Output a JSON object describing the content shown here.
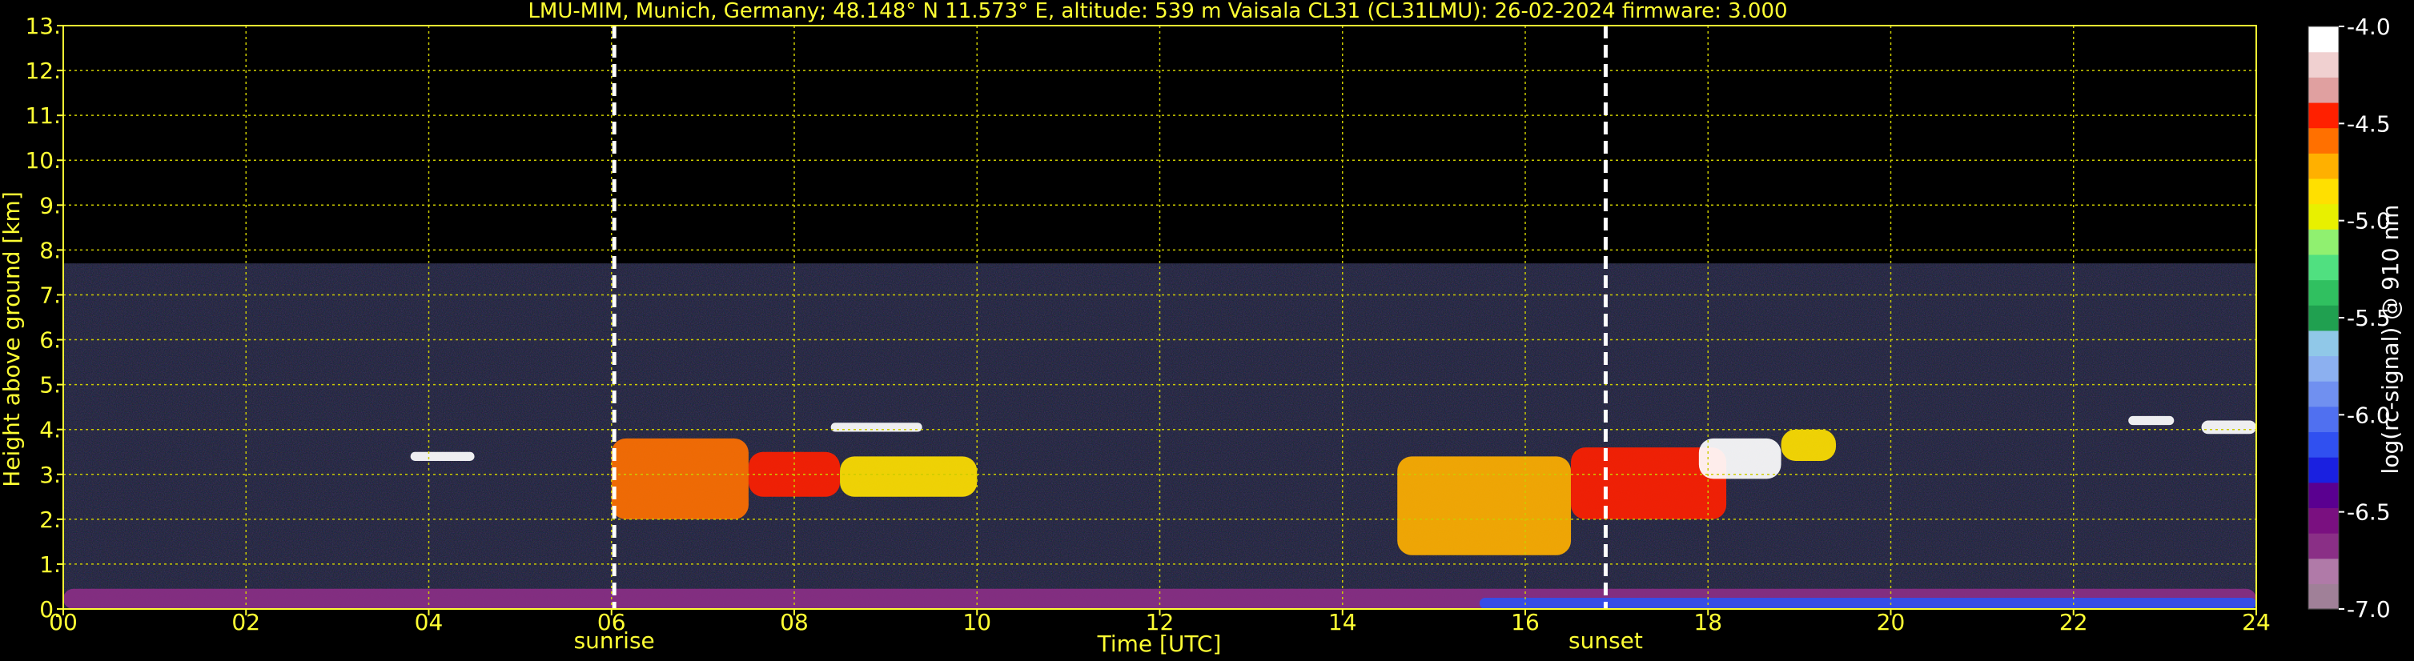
{
  "chart_data": {
    "type": "heatmap",
    "title": "LMU-MIM, Munich, Germany; 48.148° N 11.573° E, altitude: 539 m    Vaisala CL31 (CL31LMU): 26-02-2024    firmware: 3.000",
    "xlabel": "Time [UTC]",
    "ylabel": "Height above ground [km]",
    "colorbar_label": "log(rc-signal) @ 910 nm",
    "xlim": [
      0,
      24
    ],
    "ylim": [
      0,
      13
    ],
    "x_ticks": [
      0,
      2,
      4,
      6,
      8,
      10,
      12,
      14,
      16,
      18,
      20,
      22,
      24
    ],
    "x_tick_labels": [
      "00",
      "02",
      "04",
      "06",
      "08",
      "10",
      "12",
      "14",
      "16",
      "18",
      "20",
      "22",
      "24"
    ],
    "y_ticks": [
      0,
      1,
      2,
      3,
      4,
      5,
      6,
      7,
      8,
      9,
      10,
      11,
      12,
      13
    ],
    "y_tick_labels": [
      "0.",
      "1.",
      "2.",
      "3.",
      "4.",
      "5.",
      "6.",
      "7.",
      "8.",
      "9.",
      "10.",
      "11.",
      "12.",
      "13."
    ],
    "grid": true,
    "colorbar_range": [
      -7.0,
      -4.0
    ],
    "colorbar_ticks": [
      -7.0,
      -6.5,
      -6.0,
      -5.5,
      -5.0,
      -4.5,
      -4.0
    ],
    "colorbar_tick_labels": [
      "-7.0",
      "-6.5",
      "-6.0",
      "-5.5",
      "-5.0",
      "-4.5",
      "-4.0"
    ],
    "markers": [
      {
        "label": "sunrise",
        "x": 6.03
      },
      {
        "label": "sunset",
        "x": 16.88
      }
    ],
    "data_top_km": 7.7,
    "layers": [
      {
        "x_start": 0.0,
        "x_end": 24.0,
        "y_low": 0.0,
        "y_high": 0.45,
        "intensity": -6.7
      },
      {
        "x_start": 15.5,
        "x_end": 24.0,
        "y_low": 0.0,
        "y_high": 0.25,
        "intensity": -6.2
      },
      {
        "x_start": 3.8,
        "x_end": 4.5,
        "y_low": 3.3,
        "y_high": 3.5,
        "intensity": -4.1
      },
      {
        "x_start": 6.0,
        "x_end": 7.5,
        "y_low": 2.0,
        "y_high": 3.8,
        "intensity": -4.6
      },
      {
        "x_start": 7.5,
        "x_end": 8.5,
        "y_low": 2.5,
        "y_high": 3.5,
        "intensity": -4.5
      },
      {
        "x_start": 8.5,
        "x_end": 10.0,
        "y_low": 2.5,
        "y_high": 3.4,
        "intensity": -4.9
      },
      {
        "x_start": 8.4,
        "x_end": 9.4,
        "y_low": 3.95,
        "y_high": 4.15,
        "intensity": -4.1
      },
      {
        "x_start": 14.6,
        "x_end": 16.5,
        "y_low": 1.2,
        "y_high": 3.4,
        "intensity": -4.7
      },
      {
        "x_start": 16.5,
        "x_end": 18.2,
        "y_low": 2.0,
        "y_high": 3.6,
        "intensity": -4.4
      },
      {
        "x_start": 17.9,
        "x_end": 18.8,
        "y_low": 2.9,
        "y_high": 3.8,
        "intensity": -4.0
      },
      {
        "x_start": 18.8,
        "x_end": 19.4,
        "y_low": 3.3,
        "y_high": 4.0,
        "intensity": -4.8
      },
      {
        "x_start": 22.6,
        "x_end": 23.1,
        "y_low": 4.1,
        "y_high": 4.3,
        "intensity": -4.1
      },
      {
        "x_start": 23.4,
        "x_end": 24.0,
        "y_low": 3.9,
        "y_high": 4.2,
        "intensity": -4.1
      }
    ],
    "colormap": [
      "#a08098",
      "#b07aa8",
      "#8a2f86",
      "#7a1080",
      "#5a0090",
      "#1a20e0",
      "#3050f0",
      "#5070f0",
      "#7090f0",
      "#8cb0f0",
      "#90c8e8",
      "#20a050",
      "#30c060",
      "#50e080",
      "#90f070",
      "#e8f000",
      "#ffe000",
      "#ffb000",
      "#ff7000",
      "#ff2000",
      "#e0a0a0",
      "#f0d0d0",
      "#ffffff"
    ],
    "colors": {
      "text": "#ffff33",
      "grid": "#cccc00",
      "background": "#000000",
      "marker": "#ffffff",
      "colorbar_text": "#ffffff"
    }
  }
}
